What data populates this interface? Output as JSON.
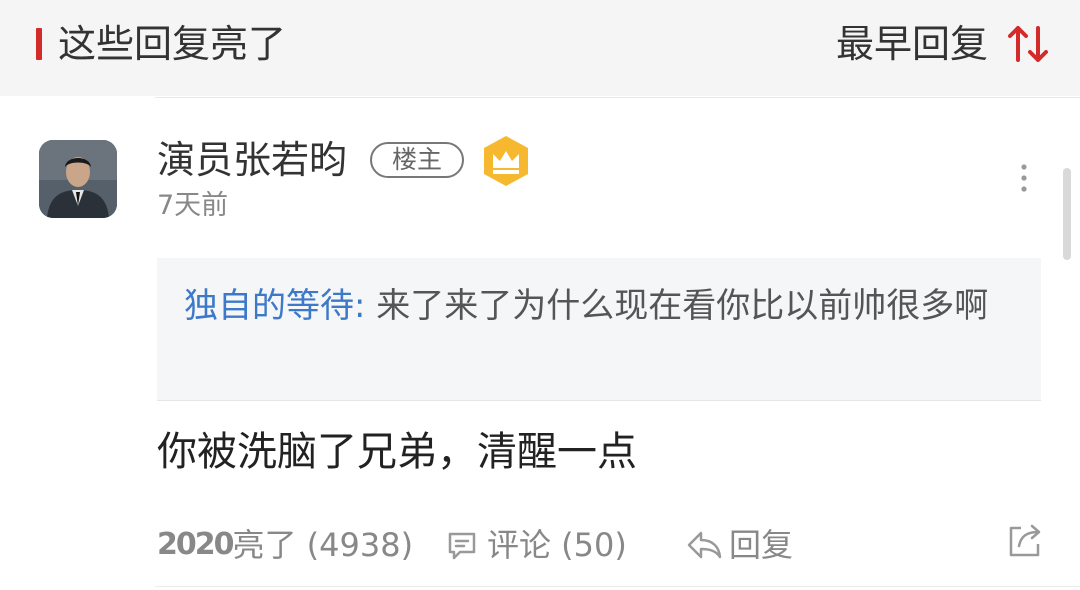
{
  "header": {
    "title": "这些回复亮了",
    "sort_label": "最早回复",
    "accent_color": "#d32a2a",
    "sort_icon": "sort-arrows-icon"
  },
  "reply": {
    "username": "演员张若昀",
    "badge": "楼主",
    "crown_icon": "crown-badge-icon",
    "timestamp": "7天前",
    "quote": {
      "author": "独自的等待:",
      "text": " 来了来了为什么现在看你比以前帅很多啊",
      "author_color": "#3d78c9"
    },
    "text": "你被洗脑了兄弟，清醒一点",
    "actions": {
      "like_prefix": "2020",
      "like_label": "亮了 (4938)",
      "comment_label": "评论 (50)",
      "reply_label": "回复"
    }
  }
}
